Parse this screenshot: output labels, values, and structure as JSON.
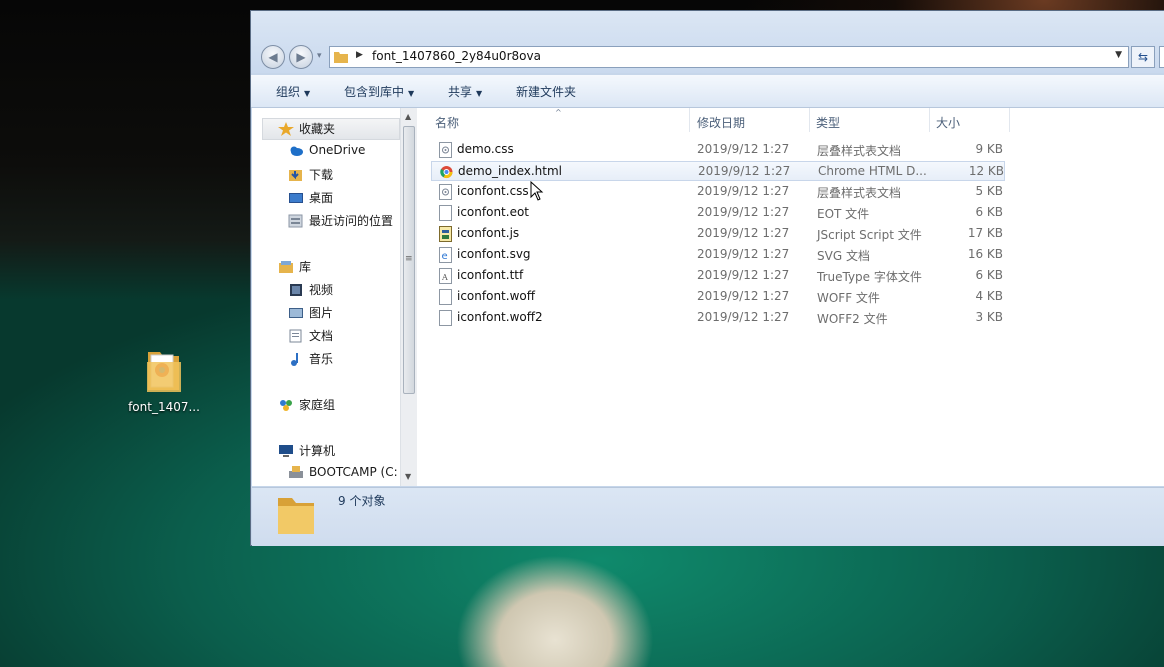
{
  "desktop": {
    "icon_label": "font_1407..."
  },
  "window": {
    "address_path": "font_1407860_2y84u0r8ova",
    "toolbar": {
      "organize": "组织",
      "include_in_library": "包含到库中",
      "share": "共享",
      "new_folder": "新建文件夹"
    },
    "nav": {
      "favorites": "收藏夹",
      "onedrive": "OneDrive",
      "downloads": "下载",
      "desktop": "桌面",
      "recent": "最近访问的位置",
      "library": "库",
      "video": "视频",
      "pictures": "图片",
      "documents": "文档",
      "music": "音乐",
      "homegroup": "家庭组",
      "computer": "计算机",
      "bootcamp": "BOOTCAMP (C:"
    },
    "columns": {
      "name": "名称",
      "date": "修改日期",
      "type": "类型",
      "size": "大小"
    },
    "files": [
      {
        "name": "demo.css",
        "date": "2019/9/12 1:27",
        "type": "层叠样式表文档",
        "size": "9 KB",
        "icon": "css-file-icon"
      },
      {
        "name": "demo_index.html",
        "date": "2019/9/12 1:27",
        "type": "Chrome HTML D...",
        "size": "12 KB",
        "icon": "chrome-file-icon"
      },
      {
        "name": "iconfont.css",
        "date": "2019/9/12 1:27",
        "type": "层叠样式表文档",
        "size": "5 KB",
        "icon": "css-file-icon"
      },
      {
        "name": "iconfont.eot",
        "date": "2019/9/12 1:27",
        "type": "EOT 文件",
        "size": "6 KB",
        "icon": "blank-file-icon"
      },
      {
        "name": "iconfont.js",
        "date": "2019/9/12 1:27",
        "type": "JScript Script 文件",
        "size": "17 KB",
        "icon": "js-file-icon"
      },
      {
        "name": "iconfont.svg",
        "date": "2019/9/12 1:27",
        "type": "SVG 文档",
        "size": "16 KB",
        "icon": "ie-file-icon"
      },
      {
        "name": "iconfont.ttf",
        "date": "2019/9/12 1:27",
        "type": "TrueType 字体文件",
        "size": "6 KB",
        "icon": "font-file-icon"
      },
      {
        "name": "iconfont.woff",
        "date": "2019/9/12 1:27",
        "type": "WOFF 文件",
        "size": "4 KB",
        "icon": "blank-file-icon"
      },
      {
        "name": "iconfont.woff2",
        "date": "2019/9/12 1:27",
        "type": "WOFF2 文件",
        "size": "3 KB",
        "icon": "blank-file-icon"
      }
    ],
    "status_count": "9 个对象"
  }
}
